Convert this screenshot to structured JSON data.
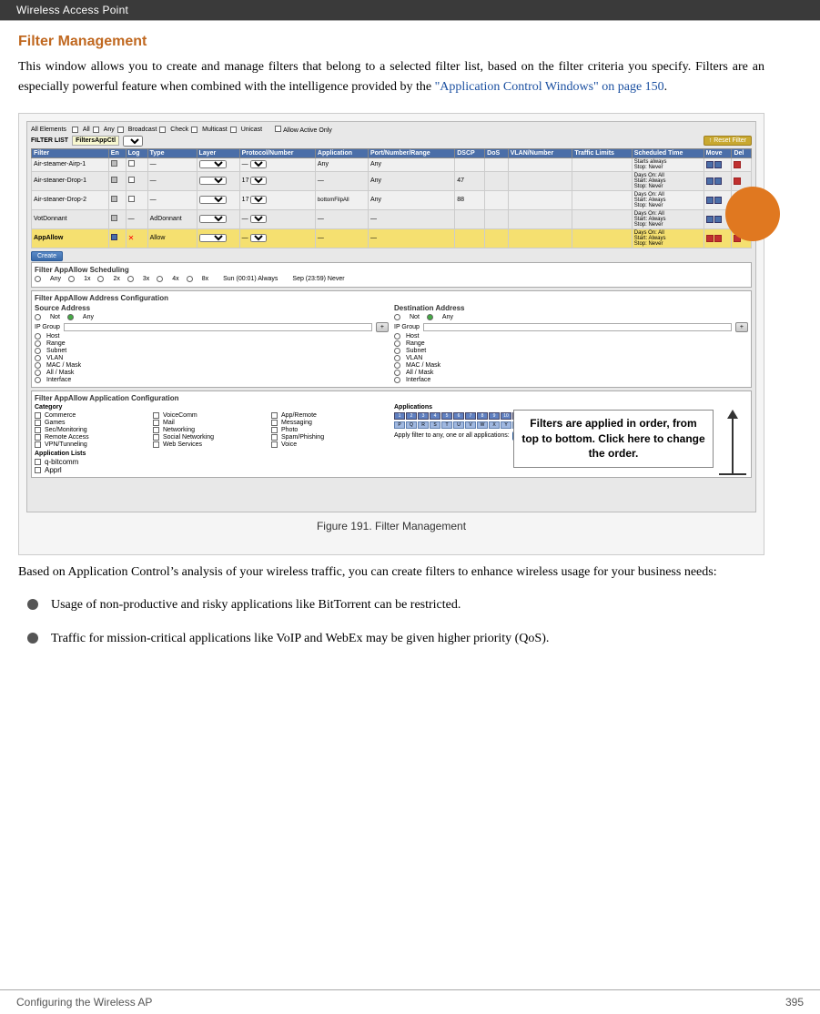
{
  "header": {
    "text": "Wireless Access Point"
  },
  "section": {
    "title": "Filter Management",
    "body_para1": "This window allows you to create and manage filters that belong to a selected filter list, based on the filter criteria you specify. Filters are an especially powerful feature when combined with the intelligence provided by the ",
    "link_text": "\"Application Control Windows\" on page 150",
    "body_para1_end": ".",
    "figure_caption": "Figure 191. Filter Management",
    "body_para2": "Based on Application Control’s analysis of your wireless traffic, you can create filters to enhance wireless usage for your business needs:",
    "bullets": [
      {
        "text": "Usage of non-productive and risky applications like BitTorrent can be restricted."
      },
      {
        "text": "Traffic for mission-critical applications like VoIP and WebEx may be given higher priority (QoS)."
      }
    ]
  },
  "annotation": {
    "text": "Filters are applied in order, from top to bottom. Click here to change the order."
  },
  "footer": {
    "left": "Configuring the Wireless AP",
    "right": "395"
  },
  "screenshot": {
    "filter_name": "FiltersAppCtl",
    "reset_btn": "Reset Filter",
    "table_headers": [
      "Filter",
      "En",
      "Log",
      "Type",
      "Layer",
      "Protocol / Number",
      "Application",
      "Port / Number / Range /",
      "DSCP",
      "DoS",
      "VLAN / Number",
      "Traffic Limits",
      "Scheduled Time",
      "Move",
      "Del"
    ],
    "table_rows": [
      {
        "name": "Air-steamer-Airp-1",
        "en": "✓",
        "log": "□",
        "type": "—",
        "app": "Any",
        "dscp": "",
        "vlan": "",
        "traffic": "",
        "sched": "Starts always\nStop: Never"
      },
      {
        "name": "Air-steamer-Drop-1",
        "en": "✓",
        "log": "□",
        "type": "17",
        "app": "—",
        "dscp": "47",
        "vlan": "",
        "traffic": "",
        "sched": "Days On: All\nStart: Always\nStop: Never"
      },
      {
        "name": "Air-steamer-Drop-2",
        "en": "✓",
        "log": "□",
        "type": "17",
        "app": "bottomFilpAll",
        "dscp": "88",
        "vlan": "",
        "traffic": "",
        "sched": "Days On: All\nStart: Always\nStop: Never"
      },
      {
        "name": "VotDonnant",
        "en": "✓",
        "log": "—",
        "type": "AdDonnant",
        "app": "—",
        "dscp": "",
        "vlan": "",
        "traffic": "",
        "sched": "Days On: All\nStart: Always\nStop: Never"
      },
      {
        "name": "AppAllow",
        "en": "✓",
        "log": "■",
        "type": "Allow",
        "app": "—",
        "dscp": "",
        "vlan": "",
        "traffic": "",
        "sched": "Days On: All\nStart: Always\nStop: Never",
        "highlight": true
      }
    ],
    "scheduling_section": "Filter AppAllow Scheduling",
    "address_section": "Filter AppAllow Address Configuration",
    "source_label": "Source Address",
    "dest_label": "Destination Address",
    "app_section": "Filter AppAllow Application Configuration",
    "category_label": "Category",
    "applications_label": "Applications",
    "categories": [
      "Commerce",
      "Games",
      "Remote Access",
      "Security Monitoring",
      "Messaging",
      "Mail",
      "Networking",
      "Social Networking",
      "Spam/Phishing",
      "Web Services",
      "Voice"
    ],
    "app_list_label": "Application Lists",
    "apply_btn": "Apply",
    "create_btn": "Create"
  }
}
